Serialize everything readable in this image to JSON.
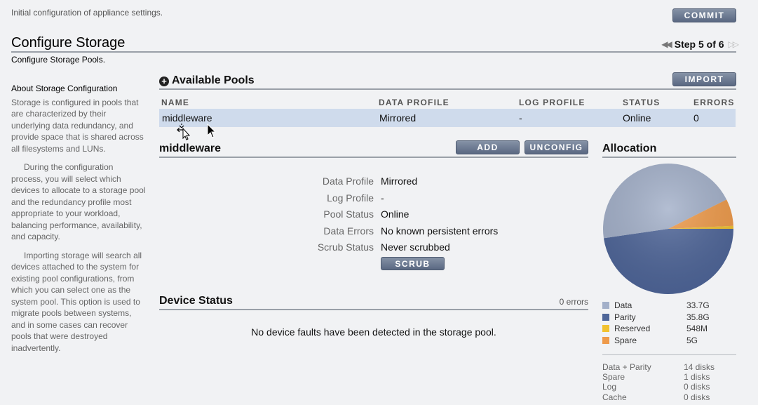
{
  "header": {
    "note": "Initial configuration of appliance settings.",
    "commit_label": "COMMIT",
    "title": "Configure Storage",
    "subtitle": "Configure Storage Pools.",
    "step": "Step 5 of 6"
  },
  "aside": {
    "heading": "About Storage Configuration",
    "p1": "Storage is configured in pools that are characterized by their underlying data redundancy, and provide space that is shared across all filesystems and LUNs.",
    "p2": "During the configuration process, you will select which devices to allocate to a storage pool and the redundancy profile most appropriate to your workload, balancing performance, availability, and capacity.",
    "p3": "Importing storage will search all devices attached to the system for existing pool configurations, from which you can select one as the system pool. This option is used to migrate pools between systems, and in some cases can recover pools that were destroyed inadvertently."
  },
  "pools": {
    "title": "Available Pools",
    "import_label": "IMPORT",
    "columns": [
      "NAME",
      "DATA PROFILE",
      "LOG PROFILE",
      "STATUS",
      "ERRORS"
    ],
    "rows": [
      {
        "name": "middleware",
        "data_profile": "Mirrored",
        "log_profile": "-",
        "status": "Online",
        "errors": "0"
      }
    ]
  },
  "pool_detail": {
    "title": "middleware",
    "add_label": "ADD",
    "unconfig_label": "UNCONFIG",
    "fields": [
      {
        "label": "Data Profile",
        "value": "Mirrored"
      },
      {
        "label": "Log Profile",
        "value": "-"
      },
      {
        "label": "Pool Status",
        "value": "Online"
      },
      {
        "label": "Data Errors",
        "value": "No known persistent errors"
      },
      {
        "label": "Scrub Status",
        "value": "Never scrubbed"
      }
    ],
    "scrub_label": "SCRUB"
  },
  "device_status": {
    "title": "Device Status",
    "errors": "0 errors",
    "message": "No device faults have been detected in the storage pool."
  },
  "allocation": {
    "title": "Allocation",
    "legend": [
      {
        "name": "Data",
        "value": "33.7G",
        "color": "#a3b0c9"
      },
      {
        "name": "Parity",
        "value": "35.8G",
        "color": "#4f6699"
      },
      {
        "name": "Reserved",
        "value": "548M",
        "color": "#f2c230"
      },
      {
        "name": "Spare",
        "value": "5G",
        "color": "#ee9a4a"
      }
    ],
    "disks": [
      {
        "label": "Data + Parity",
        "value": "14 disks"
      },
      {
        "label": "Spare",
        "value": "1 disks"
      },
      {
        "label": "Log",
        "value": "0 disks"
      },
      {
        "label": "Cache",
        "value": "0 disks"
      }
    ]
  },
  "chart_data": {
    "type": "pie",
    "categories": [
      "Data",
      "Parity",
      "Reserved",
      "Spare"
    ],
    "values": [
      33.7,
      35.8,
      0.548,
      5
    ],
    "colors": [
      "#a3b0c9",
      "#4f6699",
      "#f2c230",
      "#ee9a4a"
    ],
    "title": "Allocation"
  }
}
